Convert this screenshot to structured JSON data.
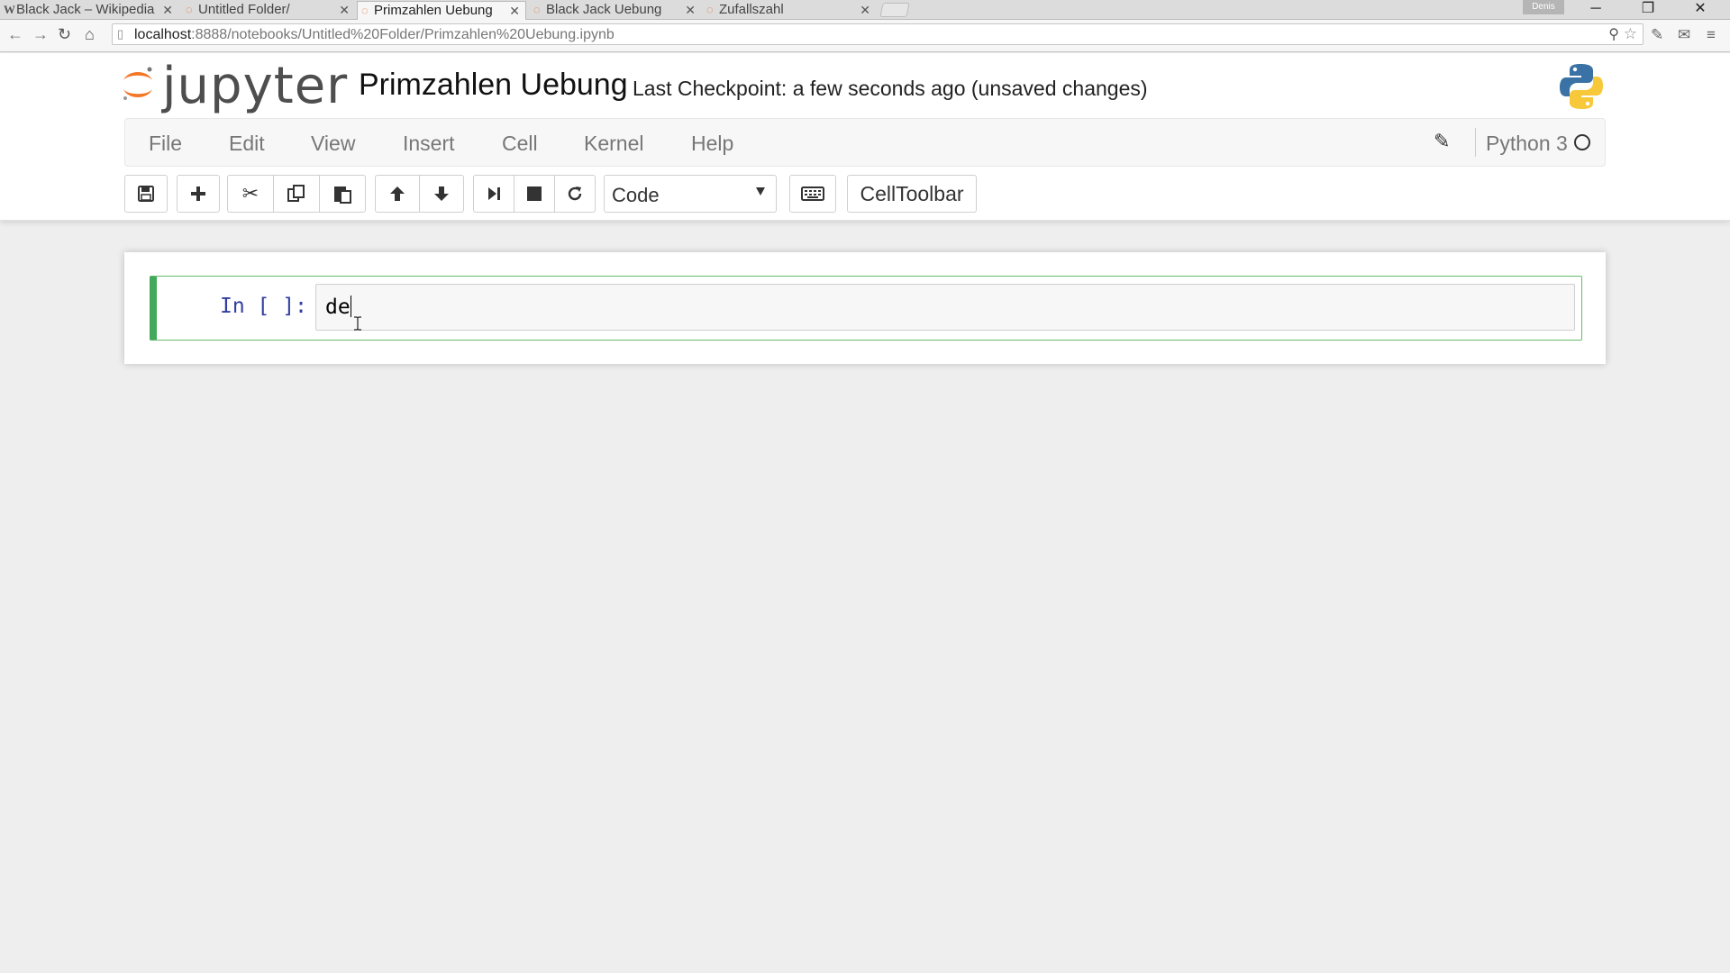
{
  "browser": {
    "tabs": [
      {
        "title": "Black Jack – Wikipedia",
        "favicon": "wikipedia-icon",
        "active": false
      },
      {
        "title": "Untitled Folder/",
        "favicon": "jupyter-icon",
        "active": false
      },
      {
        "title": "Primzahlen Uebung",
        "favicon": "jupyter-icon",
        "active": true
      },
      {
        "title": "Black Jack Uebung",
        "favicon": "jupyter-icon",
        "active": false
      },
      {
        "title": "Zufallszahl",
        "favicon": "jupyter-icon",
        "active": false
      }
    ],
    "user_badge": "Denis",
    "url_host": "localhost",
    "url_rest": ":8888/notebooks/Untitled%20Folder/Primzahlen%20Uebung.ipynb"
  },
  "jupyter": {
    "logo_text": "jupyter",
    "notebook_name": "Primzahlen Uebung",
    "checkpoint": "Last Checkpoint: a few seconds ago (unsaved changes)",
    "menu": [
      "File",
      "Edit",
      "View",
      "Insert",
      "Cell",
      "Kernel",
      "Help"
    ],
    "kernel_name": "Python 3",
    "cell_type": "Code",
    "celltoolbar_label": "CellToolbar"
  },
  "cell": {
    "prompt": "In [ ]:",
    "code": "de"
  },
  "colors": {
    "accent_green": "#42a85a",
    "prompt_blue": "#303f9f",
    "jupyter_orange": "#f37726"
  }
}
